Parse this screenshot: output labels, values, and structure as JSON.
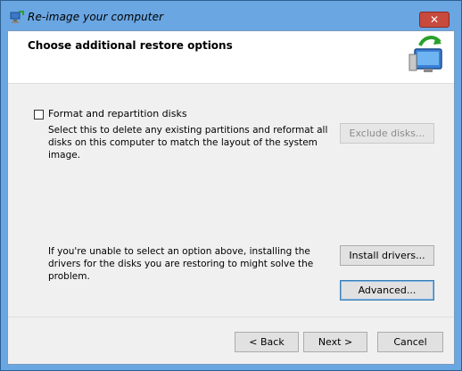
{
  "window": {
    "title": "Re-image your computer",
    "close_label": "✕"
  },
  "header": {
    "heading": "Choose additional restore options"
  },
  "options": {
    "format_label": "Format and repartition disks",
    "format_checked": false,
    "format_description": "Select this to delete any existing partitions and reformat all disks on this computer to match the layout of the system image.",
    "exclude_button": "Exclude disks...",
    "drivers_description": "If you're unable to select an option above, installing the drivers for the disks you are restoring to might solve the problem.",
    "install_button": "Install drivers...",
    "advanced_button": "Advanced..."
  },
  "footer": {
    "back_label": "< Back",
    "next_label": "Next >",
    "cancel_label": "Cancel"
  }
}
